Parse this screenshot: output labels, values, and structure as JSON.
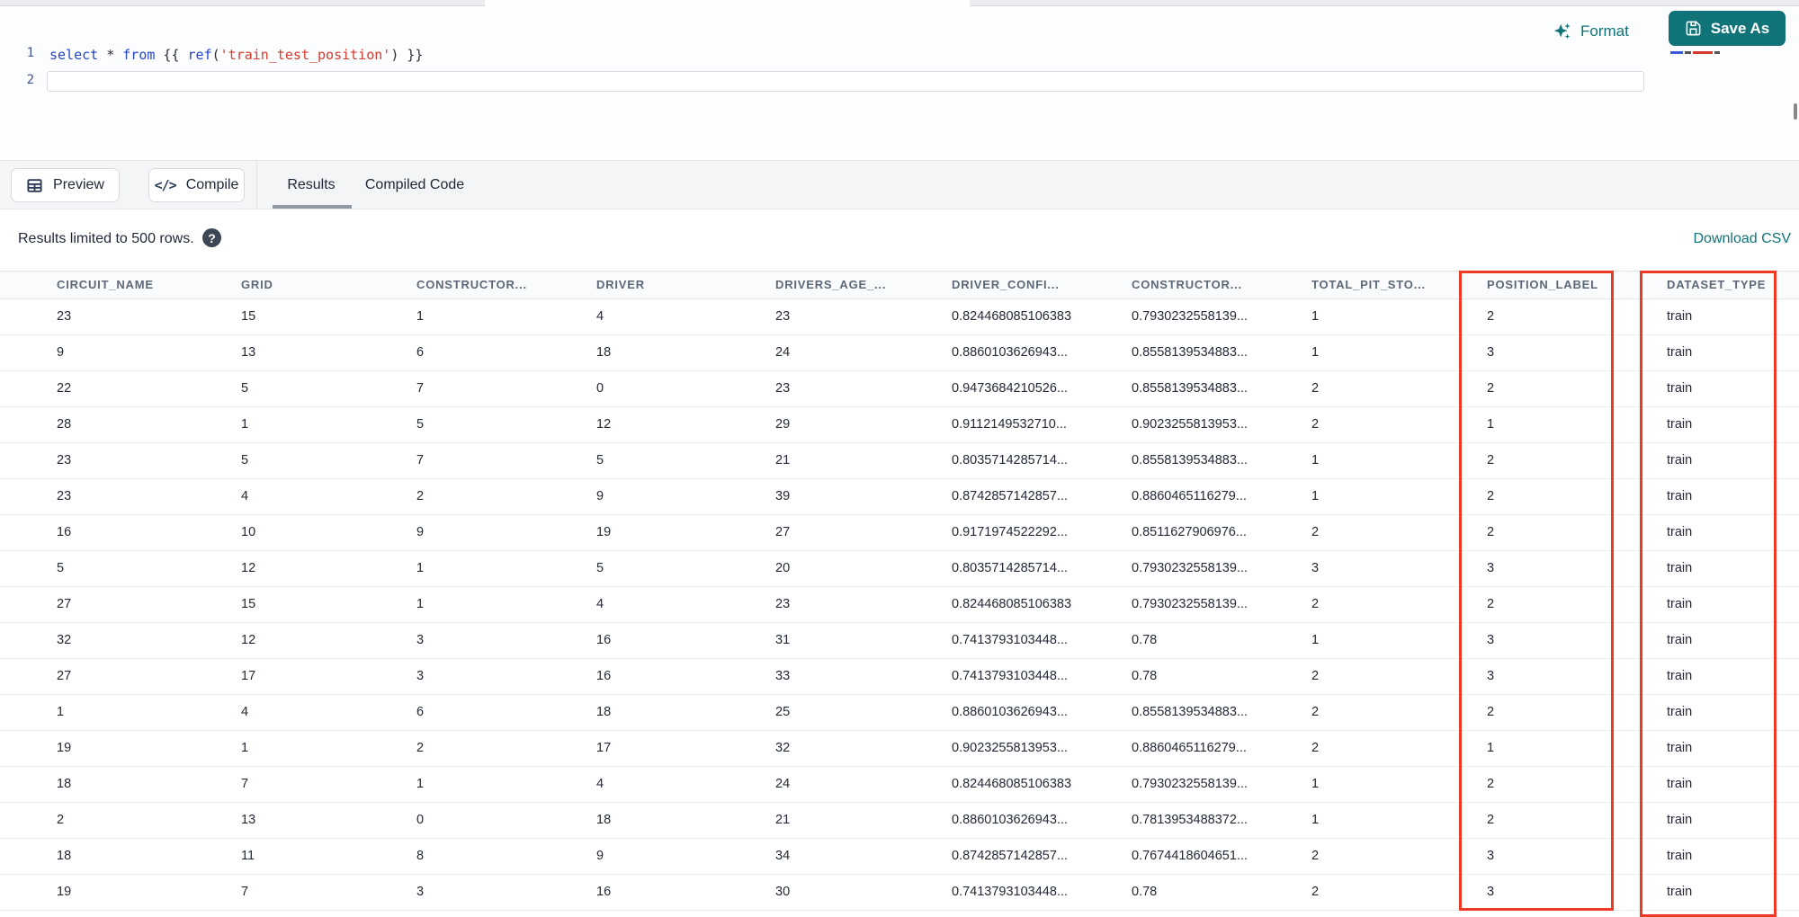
{
  "editor": {
    "line_numbers": [
      "1",
      "2"
    ],
    "code_tokens": [
      {
        "text": "select",
        "type": "keyword"
      },
      {
        "text": " ",
        "type": "plain"
      },
      {
        "text": "*",
        "type": "operator"
      },
      {
        "text": " ",
        "type": "plain"
      },
      {
        "text": "from",
        "type": "keyword"
      },
      {
        "text": " {{ ",
        "type": "plain"
      },
      {
        "text": "ref",
        "type": "function"
      },
      {
        "text": "(",
        "type": "plain"
      },
      {
        "text": "'train_test_position'",
        "type": "string"
      },
      {
        "text": ")",
        "type": "plain"
      },
      {
        "text": " }}",
        "type": "plain"
      }
    ],
    "format_label": "Format",
    "save_as_label": "Save As"
  },
  "results_toolbar": {
    "preview_label": "Preview",
    "compile_label": "Compile",
    "tabs": [
      {
        "label": "Results",
        "active": true
      },
      {
        "label": "Compiled Code",
        "active": false
      }
    ]
  },
  "results_info": {
    "limit_text": "Results limited to 500 rows.",
    "help_glyph": "?",
    "download_label": "Download CSV"
  },
  "table": {
    "columns": [
      "CIRCUIT_NAME",
      "GRID",
      "CONSTRUCTOR...",
      "DRIVER",
      "DRIVERS_AGE_...",
      "DRIVER_CONFI...",
      "CONSTRUCTOR...",
      "TOTAL_PIT_STO...",
      "POSITION_LABEL",
      "DATASET_TYPE"
    ],
    "highlighted_columns": [
      "POSITION_LABEL",
      "DATASET_TYPE"
    ],
    "rows": [
      [
        "23",
        "15",
        "1",
        "4",
        "23",
        "0.824468085106383",
        "0.7930232558139...",
        "1",
        "2",
        "train"
      ],
      [
        "9",
        "13",
        "6",
        "18",
        "24",
        "0.8860103626943...",
        "0.8558139534883...",
        "1",
        "3",
        "train"
      ],
      [
        "22",
        "5",
        "7",
        "0",
        "23",
        "0.9473684210526...",
        "0.8558139534883...",
        "2",
        "2",
        "train"
      ],
      [
        "28",
        "1",
        "5",
        "12",
        "29",
        "0.9112149532710...",
        "0.9023255813953...",
        "2",
        "1",
        "train"
      ],
      [
        "23",
        "5",
        "7",
        "5",
        "21",
        "0.8035714285714...",
        "0.8558139534883...",
        "1",
        "2",
        "train"
      ],
      [
        "23",
        "4",
        "2",
        "9",
        "39",
        "0.8742857142857...",
        "0.8860465116279...",
        "1",
        "2",
        "train"
      ],
      [
        "16",
        "10",
        "9",
        "19",
        "27",
        "0.9171974522292...",
        "0.8511627906976...",
        "2",
        "2",
        "train"
      ],
      [
        "5",
        "12",
        "1",
        "5",
        "20",
        "0.8035714285714...",
        "0.7930232558139...",
        "3",
        "3",
        "train"
      ],
      [
        "27",
        "15",
        "1",
        "4",
        "23",
        "0.824468085106383",
        "0.7930232558139...",
        "2",
        "2",
        "train"
      ],
      [
        "32",
        "12",
        "3",
        "16",
        "31",
        "0.7413793103448...",
        "0.78",
        "1",
        "3",
        "train"
      ],
      [
        "27",
        "17",
        "3",
        "16",
        "33",
        "0.7413793103448...",
        "0.78",
        "2",
        "3",
        "train"
      ],
      [
        "1",
        "4",
        "6",
        "18",
        "25",
        "0.8860103626943...",
        "0.8558139534883...",
        "2",
        "2",
        "train"
      ],
      [
        "19",
        "1",
        "2",
        "17",
        "32",
        "0.9023255813953...",
        "0.8860465116279...",
        "2",
        "1",
        "train"
      ],
      [
        "18",
        "7",
        "1",
        "4",
        "24",
        "0.824468085106383",
        "0.7930232558139...",
        "1",
        "2",
        "train"
      ],
      [
        "2",
        "13",
        "0",
        "18",
        "21",
        "0.8860103626943...",
        "0.7813953488372...",
        "1",
        "2",
        "train"
      ],
      [
        "18",
        "11",
        "8",
        "9",
        "34",
        "0.8742857142857...",
        "0.7674418604651...",
        "2",
        "3",
        "train"
      ],
      [
        "19",
        "7",
        "3",
        "16",
        "30",
        "0.7413793103448...",
        "0.78",
        "2",
        "3",
        "train"
      ]
    ]
  },
  "colors": {
    "accent_teal": "#107377",
    "highlight_red": "#ee3a24",
    "keyword_blue": "#2443c9",
    "string_red": "#d63a2f",
    "header_text": "#5d6878"
  }
}
